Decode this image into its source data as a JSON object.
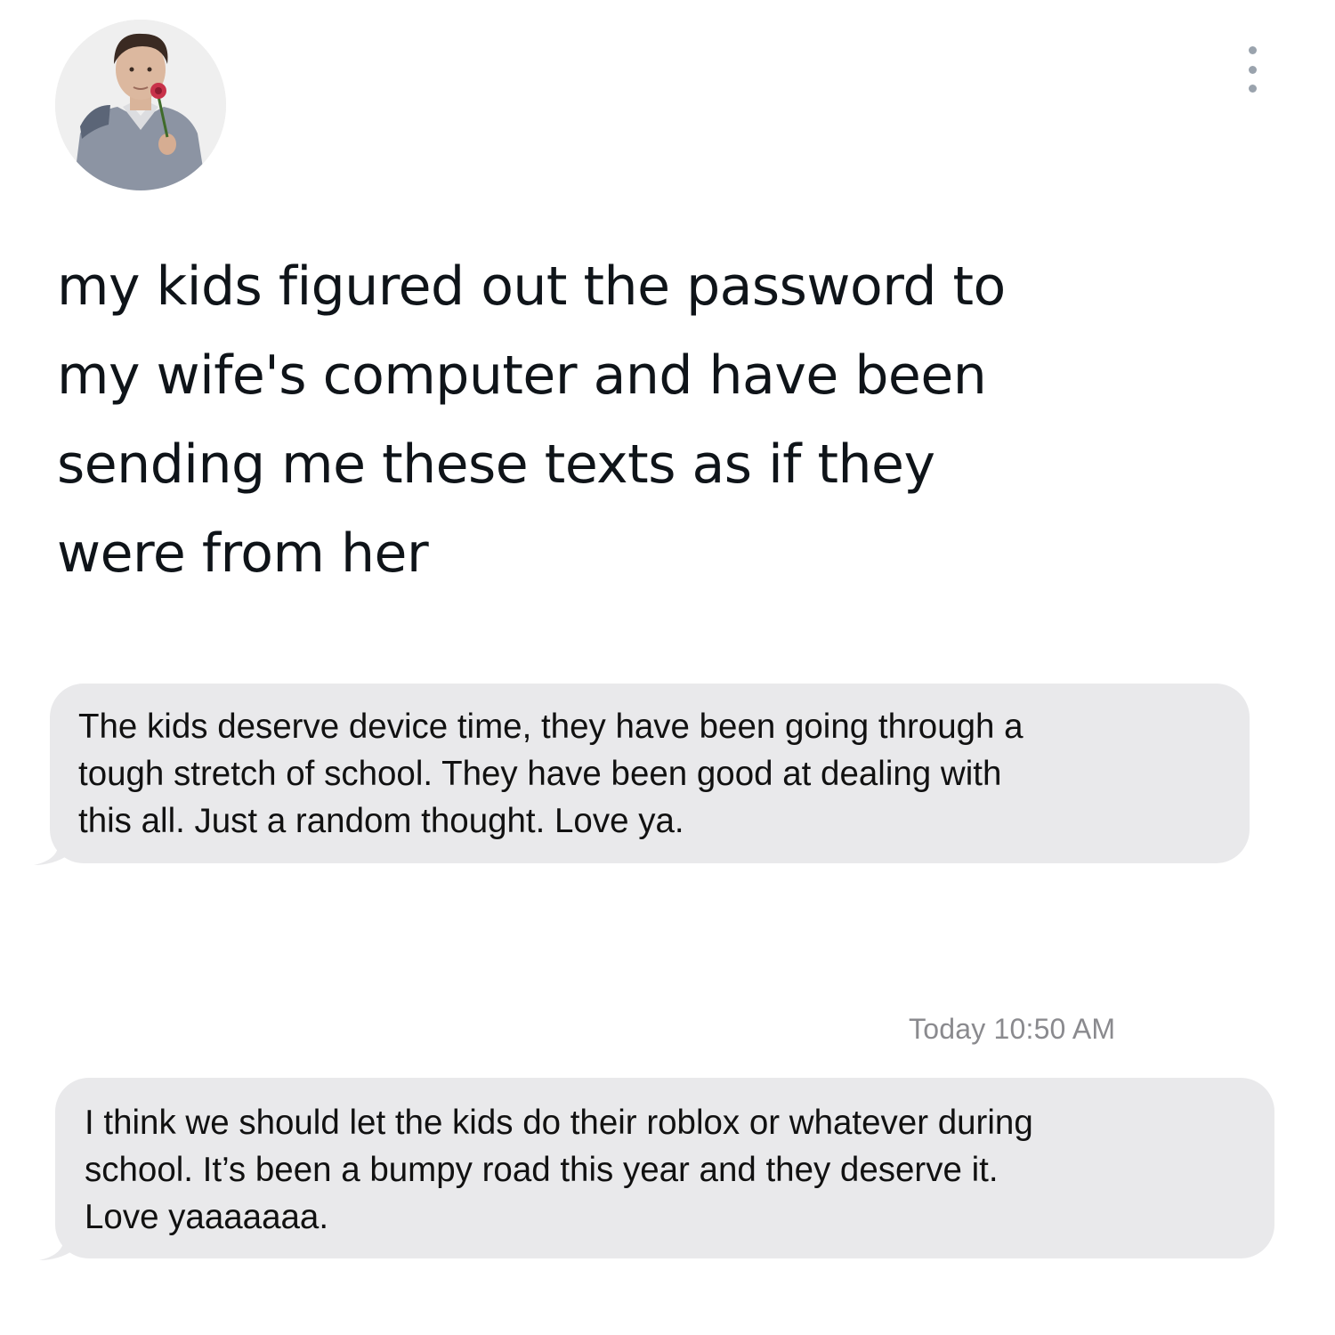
{
  "tweet": {
    "avatar_icon": "profile-photo-avatar",
    "menu_icon": "vertical-ellipsis-icon",
    "text": "my kids figured out the password to\nmy wife's computer and have been\nsending me these texts as if they\nwere from her"
  },
  "messages": [
    {
      "direction": "incoming",
      "text": "The kids deserve device time, they have been going through a\ntough stretch of school. They have been good at dealing with\nthis all. Just a random thought. Love ya."
    },
    {
      "direction": "incoming",
      "timestamp": "Today 10:50 AM",
      "text": "I think we should let the kids do their roblox or whatever during\nschool. It’s been a bumpy road this year and they deserve it.\nLove yaaaaaaa."
    }
  ],
  "colors": {
    "background": "#ffffff",
    "tweet_text": "#0f1419",
    "bubble_incoming": "#e9e9eb",
    "bubble_text": "#111111",
    "timestamp": "#8a8a8e",
    "menu_dots": "#9aa3ad"
  }
}
